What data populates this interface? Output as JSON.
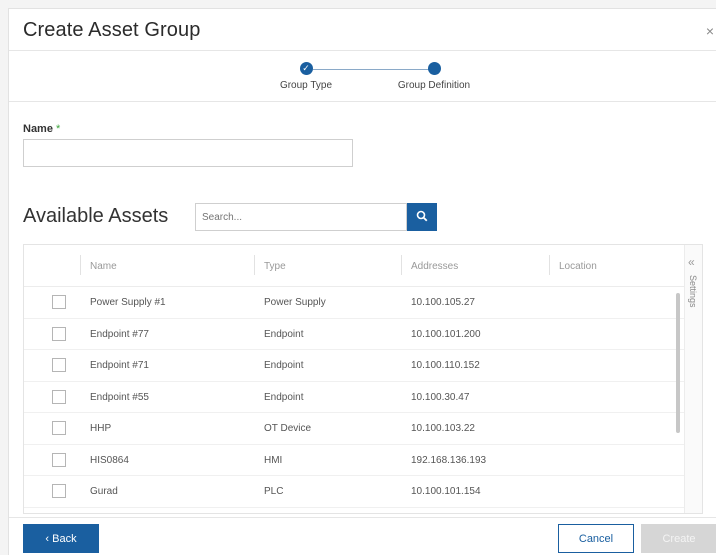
{
  "dialog": {
    "title": "Create Asset Group",
    "close": "×"
  },
  "stepper": {
    "steps": [
      {
        "label": "Group Type",
        "state": "completed",
        "glyph": "✓"
      },
      {
        "label": "Group Definition",
        "state": "active",
        "glyph": ""
      }
    ]
  },
  "form": {
    "name_label": "Name",
    "required_mark": "*",
    "name_value": ""
  },
  "assets": {
    "title": "Available Assets",
    "search_placeholder": "Search...",
    "columns": [
      "Name",
      "Type",
      "Addresses",
      "Location"
    ],
    "rows": [
      {
        "name": "Power Supply #1",
        "type": "Power Supply",
        "address": "10.100.105.27"
      },
      {
        "name": "Endpoint #77",
        "type": "Endpoint",
        "address": "10.100.101.200"
      },
      {
        "name": "Endpoint #71",
        "type": "Endpoint",
        "address": "10.100.110.152"
      },
      {
        "name": "Endpoint #55",
        "type": "Endpoint",
        "address": "10.100.30.47"
      },
      {
        "name": "HHP",
        "type": "OT Device",
        "address": "10.100.103.22"
      },
      {
        "name": "HIS0864",
        "type": "HMI",
        "address": "192.168.136.193"
      },
      {
        "name": "Gurad",
        "type": "PLC",
        "address": "10.100.101.154"
      }
    ],
    "settings_label": "Settings",
    "settings_chevron": "«"
  },
  "footer": {
    "back_label": "‹ Back",
    "cancel_label": "Cancel",
    "create_label": "Create"
  },
  "colors": {
    "accent": "#1a5fa0",
    "required": "#3da53d",
    "disabled": "#d6d6d6"
  }
}
